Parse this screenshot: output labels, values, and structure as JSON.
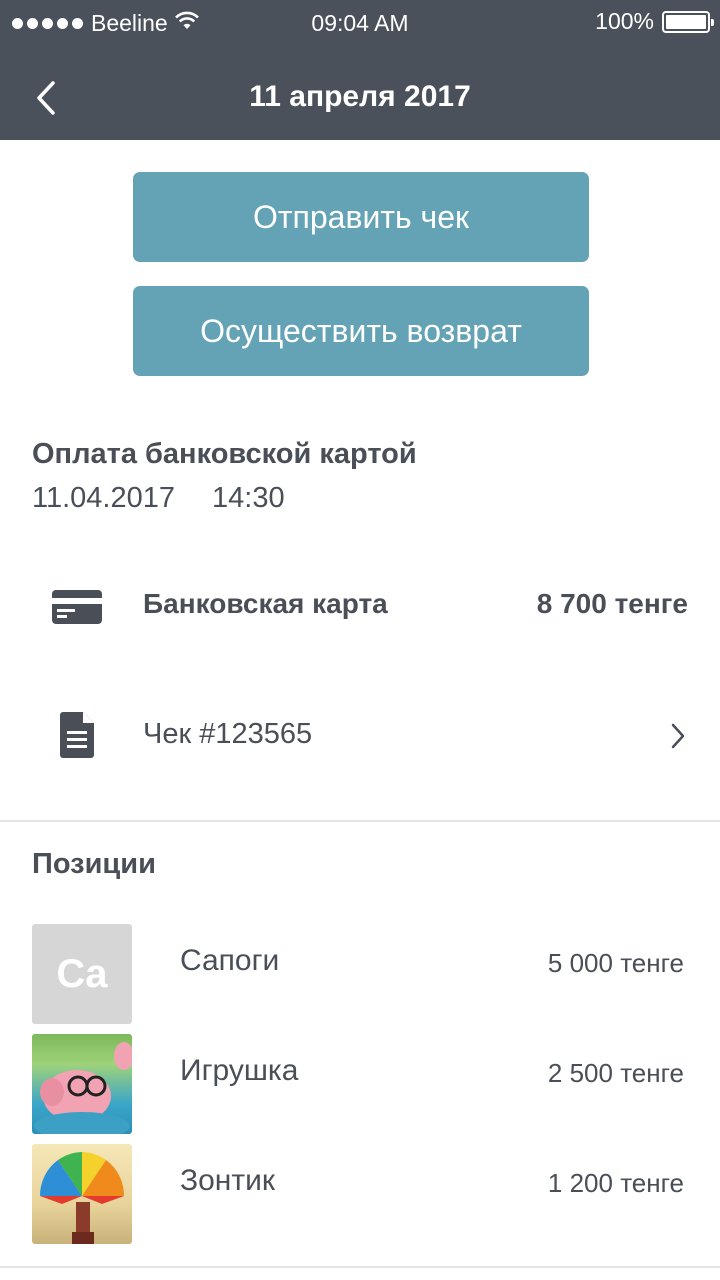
{
  "status": {
    "carrier": "Beeline",
    "time": "09:04 AM",
    "battery": "100%"
  },
  "nav": {
    "title": "11 апреля 2017"
  },
  "actions": {
    "send_label": "Отправить чек",
    "refund_label": "Осуществить возврат"
  },
  "payment": {
    "title": "Оплата банковской картой",
    "date": "11.04.2017",
    "time": "14:30",
    "method_label": "Банковская карта",
    "amount": "8 700 тенге",
    "receipt_label": "Чек #123565"
  },
  "positions": {
    "title": "Позиции",
    "items": [
      {
        "name": "Сапоги",
        "price": "5 000 тенге",
        "thumb_text": "Ca"
      },
      {
        "name": "Игрушка",
        "price": "2 500 тенге"
      },
      {
        "name": "Зонтик",
        "price": "1 200 тенге"
      }
    ]
  },
  "colors": {
    "header_bg": "#4a515b",
    "button_bg": "#64a2b6",
    "text": "#4a4f57"
  }
}
